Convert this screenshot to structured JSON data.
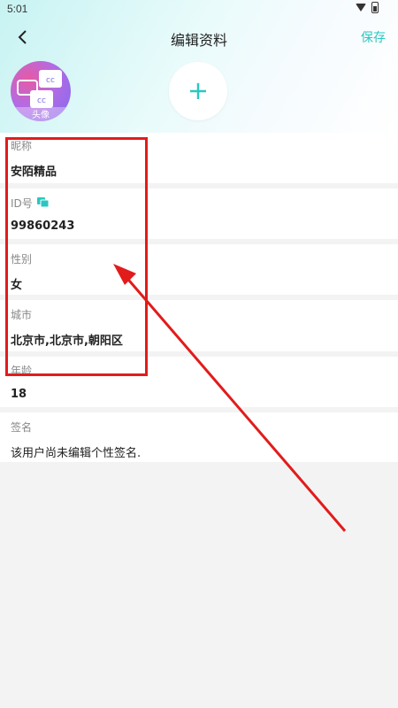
{
  "status": {
    "time": "5:01"
  },
  "header": {
    "title": "编辑资料",
    "save_label": "保存"
  },
  "avatar": {
    "badge": "头像",
    "icon": "cc-chat-icon"
  },
  "add_photo": {
    "symbol": "+"
  },
  "fields": {
    "nickname": {
      "label": "昵称",
      "value": "安陌精品"
    },
    "id": {
      "label": "ID号",
      "value": "99860243"
    },
    "gender": {
      "label": "性别",
      "value": "女"
    },
    "city": {
      "label": "城市",
      "value": "北京市,北京市,朝阳区"
    },
    "age": {
      "label": "年龄",
      "value": "18"
    },
    "signature": {
      "label": "签名",
      "value": "该用户尚未编辑个性签名."
    }
  },
  "colors": {
    "accent": "#2ac7c0",
    "annotation": "#e21b1b"
  }
}
